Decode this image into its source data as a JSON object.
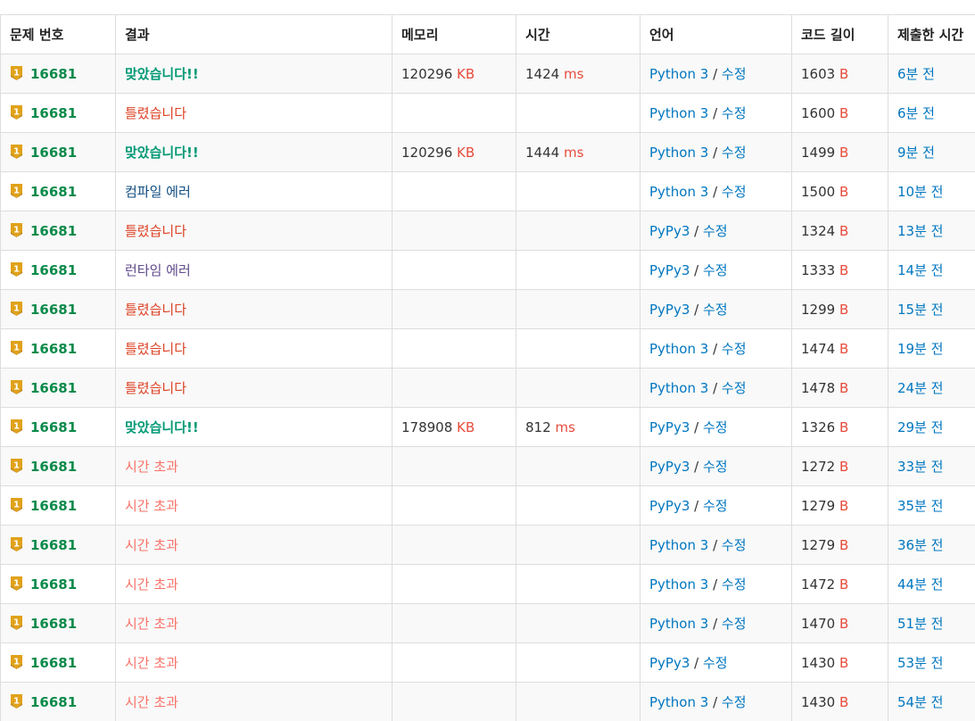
{
  "headers": [
    "문제 번호",
    "결과",
    "메모리",
    "시간",
    "언어",
    "코드 길이",
    "제출한 시간"
  ],
  "units": {
    "memory": "KB",
    "time": "ms",
    "length": "B"
  },
  "edit_label": "수정",
  "colors": {
    "accepted": "#009874",
    "wrong": "#dd4124",
    "compile": "#0f4c81",
    "runtime": "#5f4b8b",
    "timeout": "#fa7268",
    "unit": "#e74c3c",
    "link": "#0076c0",
    "tier": "#e0a21a"
  },
  "tier_icon": "bronze-tier-1-icon",
  "tier_text": "1",
  "rows": [
    {
      "problem": "16681",
      "result": "맞았습니다!!",
      "status": "ac",
      "memory": "120296",
      "time": "1424",
      "lang": "Python 3",
      "length": "1603",
      "submitted": "6분 전"
    },
    {
      "problem": "16681",
      "result": "틀렸습니다",
      "status": "wa",
      "memory": "",
      "time": "",
      "lang": "Python 3",
      "length": "1600",
      "submitted": "6분 전"
    },
    {
      "problem": "16681",
      "result": "맞았습니다!!",
      "status": "ac",
      "memory": "120296",
      "time": "1444",
      "lang": "Python 3",
      "length": "1499",
      "submitted": "9분 전"
    },
    {
      "problem": "16681",
      "result": "컴파일 에러",
      "status": "ce",
      "memory": "",
      "time": "",
      "lang": "Python 3",
      "length": "1500",
      "submitted": "10분 전"
    },
    {
      "problem": "16681",
      "result": "틀렸습니다",
      "status": "wa",
      "memory": "",
      "time": "",
      "lang": "PyPy3",
      "length": "1324",
      "submitted": "13분 전"
    },
    {
      "problem": "16681",
      "result": "런타임 에러",
      "status": "rte",
      "memory": "",
      "time": "",
      "lang": "PyPy3",
      "length": "1333",
      "submitted": "14분 전"
    },
    {
      "problem": "16681",
      "result": "틀렸습니다",
      "status": "wa",
      "memory": "",
      "time": "",
      "lang": "PyPy3",
      "length": "1299",
      "submitted": "15분 전"
    },
    {
      "problem": "16681",
      "result": "틀렸습니다",
      "status": "wa",
      "memory": "",
      "time": "",
      "lang": "Python 3",
      "length": "1474",
      "submitted": "19분 전"
    },
    {
      "problem": "16681",
      "result": "틀렸습니다",
      "status": "wa",
      "memory": "",
      "time": "",
      "lang": "Python 3",
      "length": "1478",
      "submitted": "24분 전"
    },
    {
      "problem": "16681",
      "result": "맞았습니다!!",
      "status": "ac",
      "memory": "178908",
      "time": "812",
      "lang": "PyPy3",
      "length": "1326",
      "submitted": "29분 전"
    },
    {
      "problem": "16681",
      "result": "시간 초과",
      "status": "tle",
      "memory": "",
      "time": "",
      "lang": "PyPy3",
      "length": "1272",
      "submitted": "33분 전"
    },
    {
      "problem": "16681",
      "result": "시간 초과",
      "status": "tle",
      "memory": "",
      "time": "",
      "lang": "PyPy3",
      "length": "1279",
      "submitted": "35분 전"
    },
    {
      "problem": "16681",
      "result": "시간 초과",
      "status": "tle",
      "memory": "",
      "time": "",
      "lang": "Python 3",
      "length": "1279",
      "submitted": "36분 전"
    },
    {
      "problem": "16681",
      "result": "시간 초과",
      "status": "tle",
      "memory": "",
      "time": "",
      "lang": "Python 3",
      "length": "1472",
      "submitted": "44분 전"
    },
    {
      "problem": "16681",
      "result": "시간 초과",
      "status": "tle",
      "memory": "",
      "time": "",
      "lang": "Python 3",
      "length": "1470",
      "submitted": "51분 전"
    },
    {
      "problem": "16681",
      "result": "시간 초과",
      "status": "tle",
      "memory": "",
      "time": "",
      "lang": "PyPy3",
      "length": "1430",
      "submitted": "53분 전"
    },
    {
      "problem": "16681",
      "result": "시간 초과",
      "status": "tle",
      "memory": "",
      "time": "",
      "lang": "Python 3",
      "length": "1430",
      "submitted": "54분 전"
    }
  ]
}
